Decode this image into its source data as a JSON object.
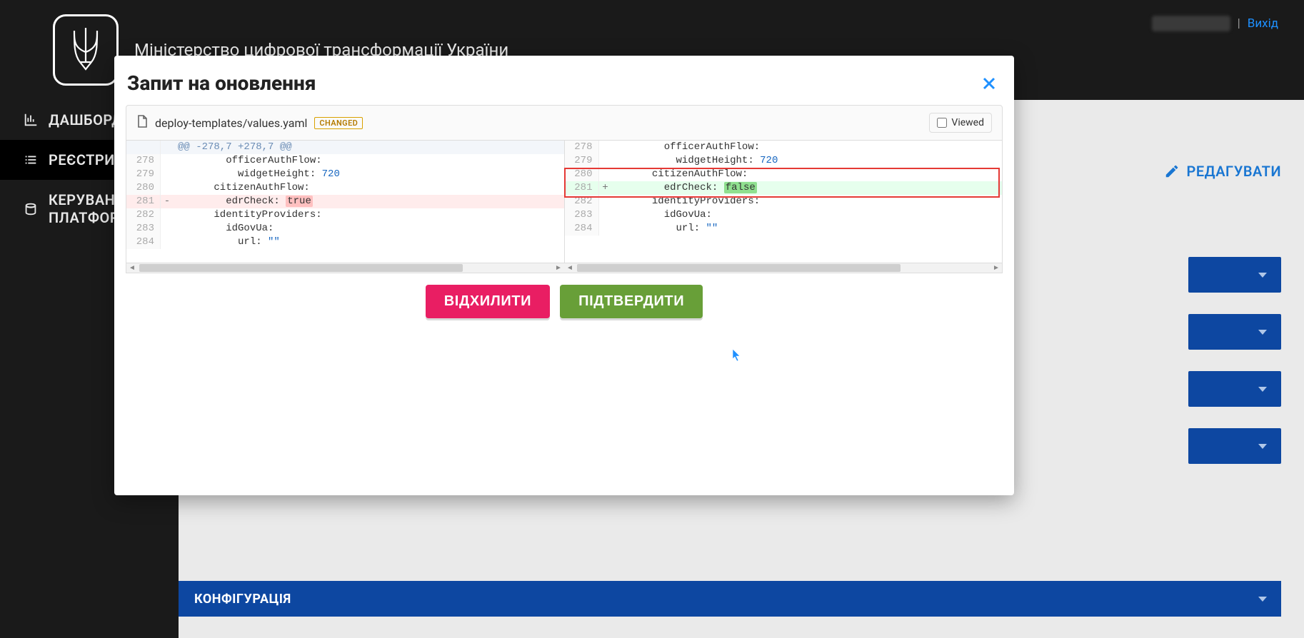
{
  "header": {
    "ministry": "Міністерство цифрової трансформації України",
    "logout": "Вихід",
    "separator": "|"
  },
  "sidebar": {
    "items": [
      {
        "label": "ДАШБОРД"
      },
      {
        "label": "РЕЄСТРИ"
      },
      {
        "label": "КЕРУВАННЯ ПЛАТФОРМОЮ"
      }
    ]
  },
  "page": {
    "editLabel": "РЕДАГУВАТИ",
    "configLabel": "КОНФІГУРАЦІЯ"
  },
  "modal": {
    "title": "Запит на оновлення",
    "filePath": "deploy-templates/values.yaml",
    "changedBadge": "CHANGED",
    "viewedLabel": "Viewed",
    "rejectLabel": "ВІДХИЛИТИ",
    "approveLabel": "ПІДТВЕРДИТИ"
  },
  "diff": {
    "hunk": "@@ -278,7 +278,7 @@",
    "left": [
      {
        "n": "",
        "sign": "",
        "text": "@@ -278,7 +278,7 @@",
        "kind": "hunk"
      },
      {
        "n": "278",
        "sign": "",
        "text": "        officerAuthFlow:",
        "kind": "ctx"
      },
      {
        "n": "279",
        "sign": "",
        "text": "          widgetHeight: ",
        "tail": "720",
        "tailcls": "num",
        "kind": "ctx"
      },
      {
        "n": "280",
        "sign": "",
        "text": "      citizenAuthFlow:",
        "kind": "ctx"
      },
      {
        "n": "281",
        "sign": "-",
        "text": "        edrCheck: ",
        "tail": "true",
        "tailcls": "hl-del",
        "kind": "del"
      },
      {
        "n": "282",
        "sign": "",
        "text": "      identityProviders:",
        "kind": "ctx"
      },
      {
        "n": "283",
        "sign": "",
        "text": "        idGovUa:",
        "kind": "ctx"
      },
      {
        "n": "284",
        "sign": "",
        "text": "          url: ",
        "tail": "\"\"",
        "tailcls": "str",
        "kind": "ctx"
      }
    ],
    "right": [
      {
        "n": "278",
        "sign": "",
        "text": "        officerAuthFlow:",
        "kind": "ctx"
      },
      {
        "n": "279",
        "sign": "",
        "text": "          widgetHeight: ",
        "tail": "720",
        "tailcls": "num",
        "kind": "ctx"
      },
      {
        "n": "280",
        "sign": "",
        "text": "      citizenAuthFlow:",
        "kind": "ctx"
      },
      {
        "n": "281",
        "sign": "+",
        "text": "        edrCheck: ",
        "tail": "false",
        "tailcls": "hl-add",
        "kind": "add"
      },
      {
        "n": "282",
        "sign": "",
        "text": "      identityProviders:",
        "kind": "ctx"
      },
      {
        "n": "283",
        "sign": "",
        "text": "        idGovUa:",
        "kind": "ctx"
      },
      {
        "n": "284",
        "sign": "",
        "text": "          url: ",
        "tail": "\"\"",
        "tailcls": "str",
        "kind": "ctx"
      }
    ]
  }
}
